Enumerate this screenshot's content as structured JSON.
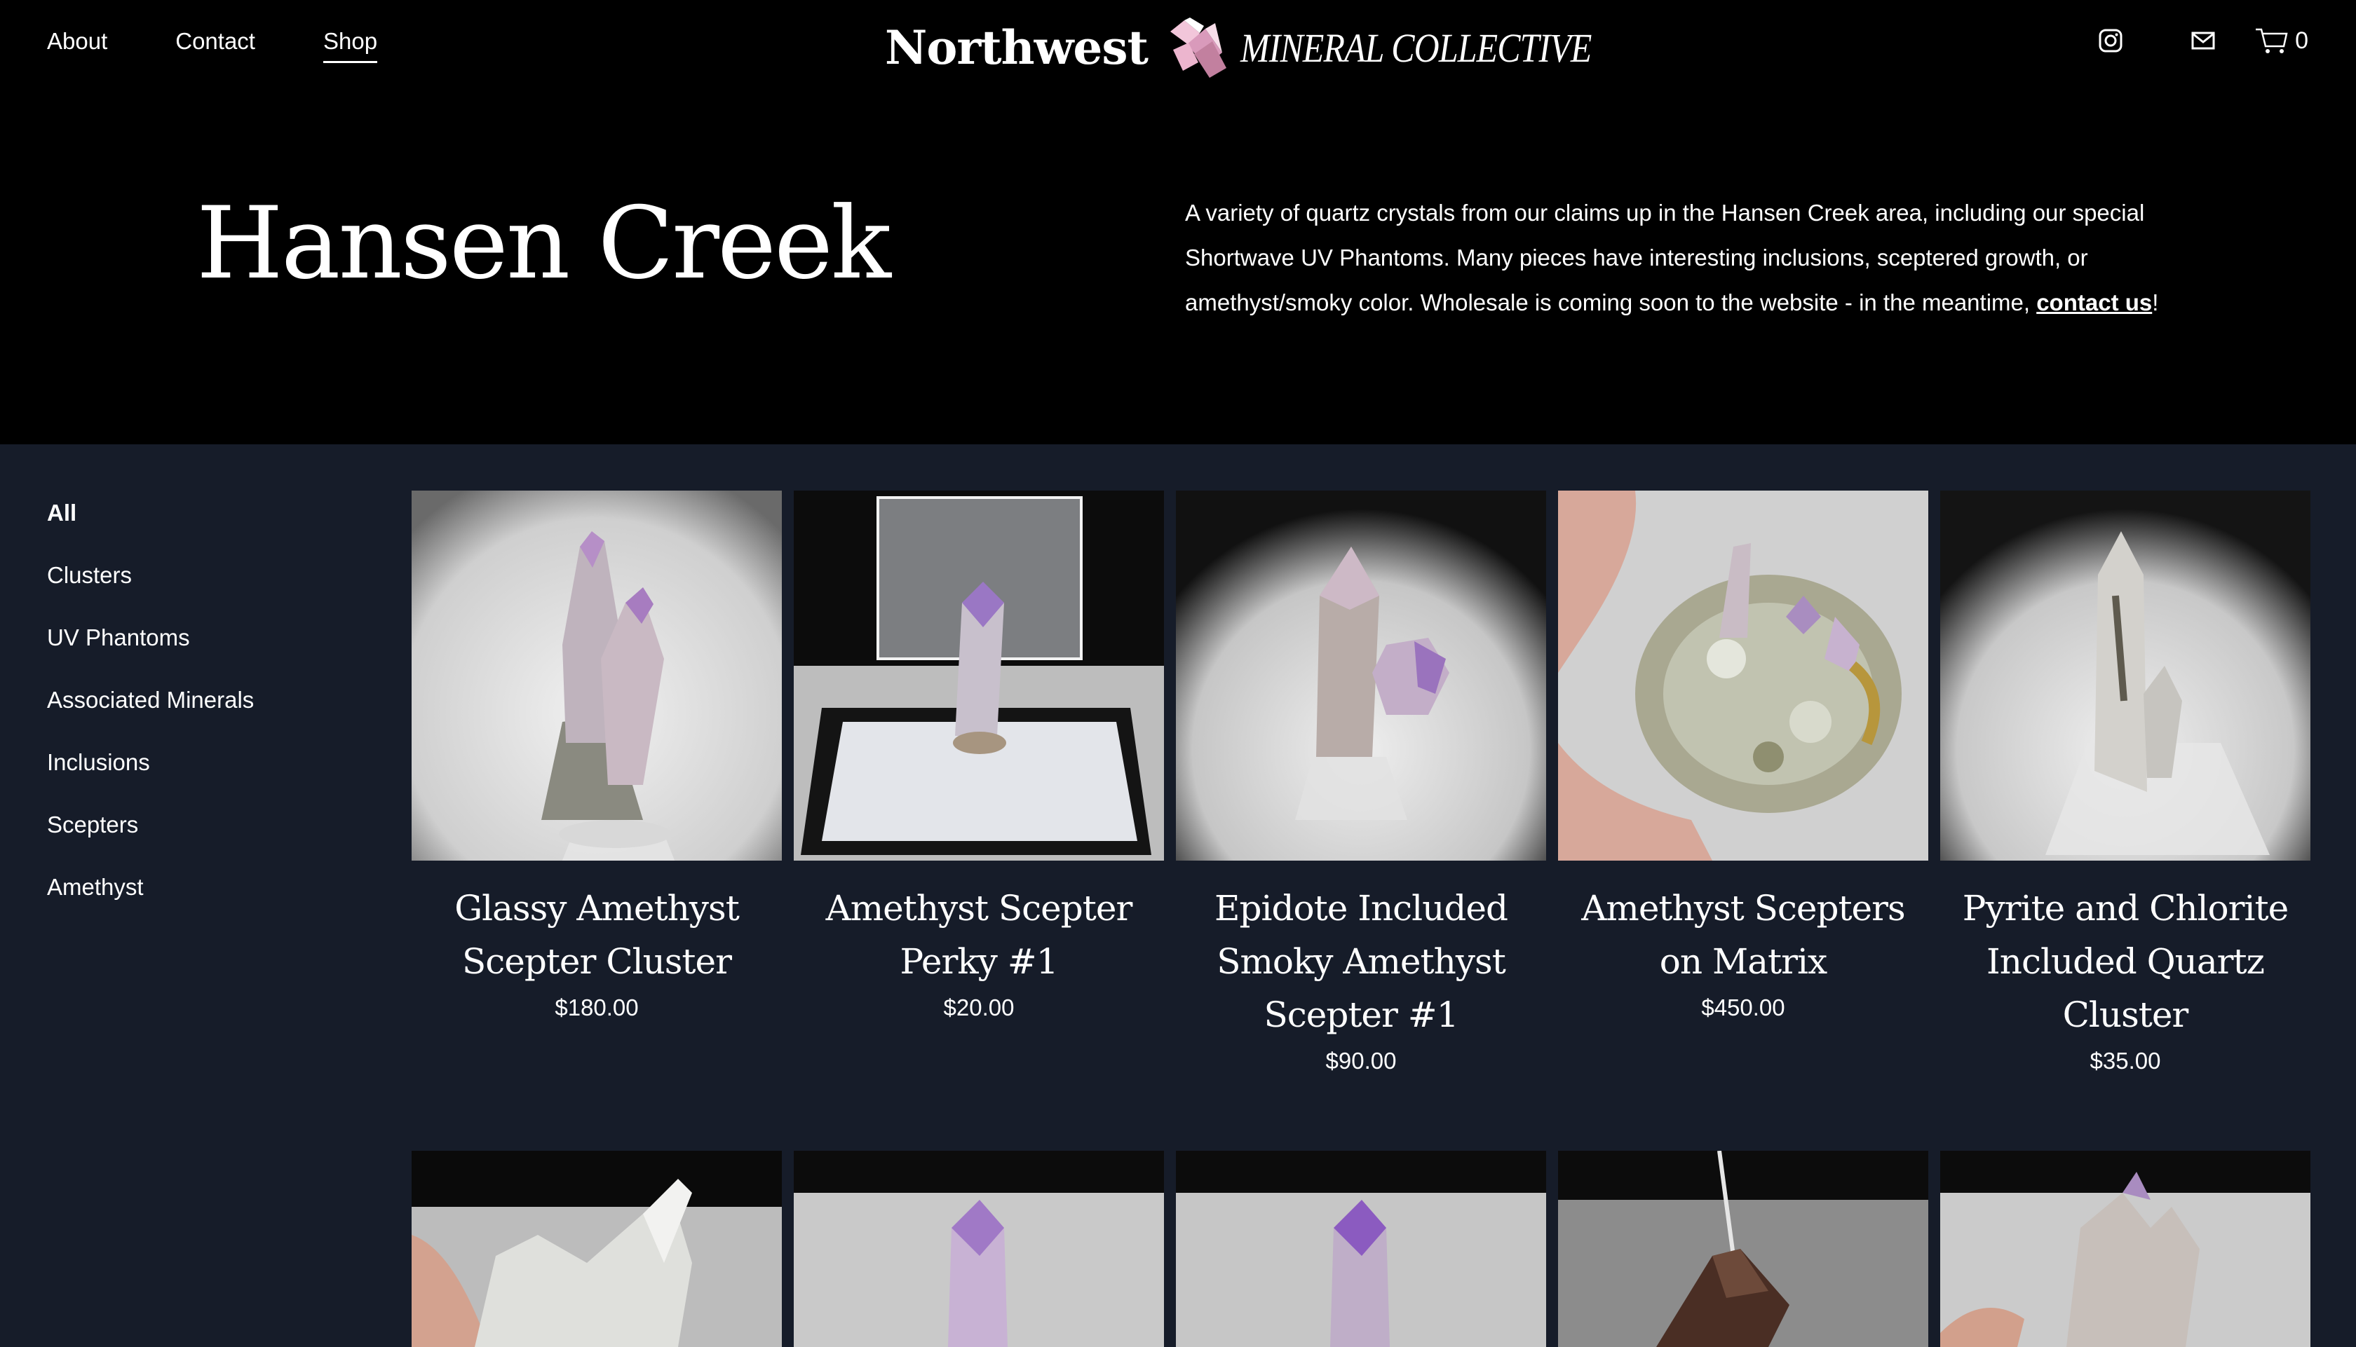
{
  "nav": {
    "items": [
      {
        "label": "About",
        "active": false
      },
      {
        "label": "Contact",
        "active": false
      },
      {
        "label": "Shop",
        "active": true
      }
    ]
  },
  "logo": {
    "word": "Northwest",
    "sub": "MINERAL COLLECTIVE"
  },
  "header_icons": {
    "instagram": "instagram-icon",
    "email": "mail-icon",
    "cart": "cart-icon",
    "cart_count": "0"
  },
  "hero": {
    "title": "Hansen Creek",
    "description": "A variety of quartz crystals from our claims up in the Hansen Creek area, including our special Shortwave UV Phantoms. Many pieces have interesting inclusions, sceptered growth, or amethyst/smoky color. Wholesale is coming soon to the website - in the meantime, ",
    "link_text": "contact us",
    "description_end": "!"
  },
  "categories": [
    {
      "label": "All",
      "active": true
    },
    {
      "label": "Clusters",
      "active": false
    },
    {
      "label": "UV Phantoms",
      "active": false
    },
    {
      "label": "Associated Minerals",
      "active": false
    },
    {
      "label": "Inclusions",
      "active": false
    },
    {
      "label": "Scepters",
      "active": false
    },
    {
      "label": "Amethyst",
      "active": false
    }
  ],
  "products": [
    {
      "name": "Glassy Amethyst Scepter Cluster",
      "price": "$180.00"
    },
    {
      "name": "Amethyst Scepter Perky #1",
      "price": "$20.00"
    },
    {
      "name": "Epidote Included Smoky Amethyst Scepter #1",
      "price": "$90.00"
    },
    {
      "name": "Amethyst Scepters on Matrix",
      "price": "$450.00"
    },
    {
      "name": "Pyrite and Chlorite Included Quartz Cluster",
      "price": "$35.00"
    }
  ],
  "colors": {
    "header_bg": "#000000",
    "body_bg": "#161c29",
    "text": "#ffffff"
  }
}
